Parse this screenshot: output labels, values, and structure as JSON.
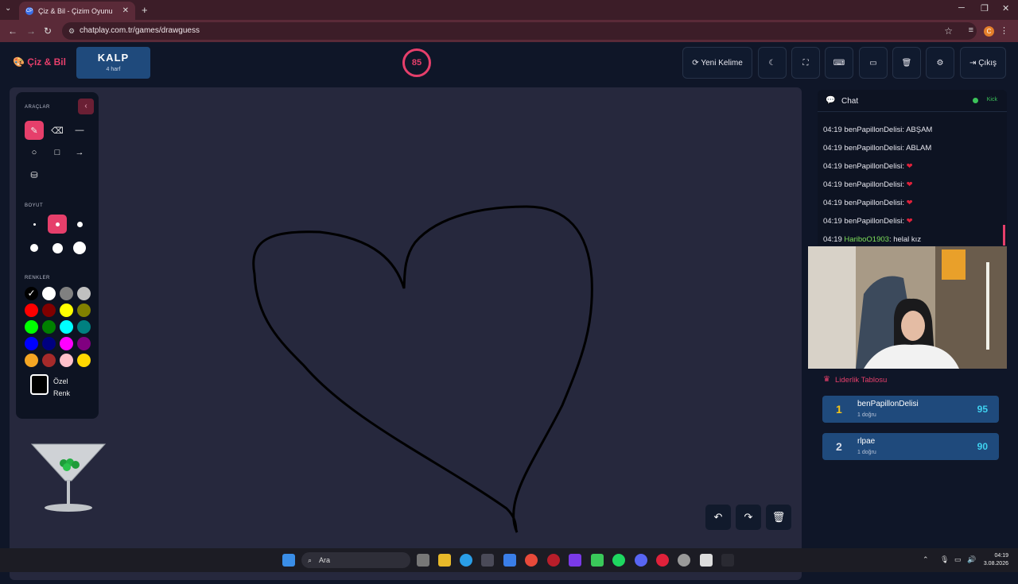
{
  "browser": {
    "tab_title": "Çiz & Bil - Çizim Oyunu",
    "url": "chatplay.com.tr/games/drawguess",
    "profile_initial": "C"
  },
  "header": {
    "logo": "Çiz & Bil",
    "word": "KALP",
    "word_hint": "4 harf",
    "timer": "85",
    "new_word": "Yeni Kelime",
    "exit": "Çıkış"
  },
  "tools": {
    "tools_label": "ARAÇLAR",
    "size_label": "BOYUT",
    "colors_label": "RENKLER",
    "custom_color": "Özel",
    "custom_color2": "Renk",
    "colors": [
      "#000000",
      "#ffffff",
      "#808080",
      "#c0c0c0",
      "#ff0000",
      "#800000",
      "#ffff00",
      "#808000",
      "#00ff00",
      "#008000",
      "#00ffff",
      "#008080",
      "#0000ff",
      "#000080",
      "#ff00ff",
      "#800080",
      "#f5a623",
      "#a52a2a",
      "#ffc0cb",
      "#ffd700"
    ]
  },
  "chat": {
    "title": "Chat",
    "platform": "Kick",
    "messages": [
      {
        "time": "04:19",
        "user": "benPapillonDelisi",
        "text": "ABŞAM"
      },
      {
        "time": "04:19",
        "user": "benPapillonDelisi",
        "text": "ABLAM"
      },
      {
        "time": "04:19",
        "user": "benPapillonDelisi",
        "text": "❤"
      },
      {
        "time": "04:19",
        "user": "benPapillonDelisi",
        "text": "❤"
      },
      {
        "time": "04:19",
        "user": "benPapillonDelisi",
        "text": "❤"
      },
      {
        "time": "04:19",
        "user": "benPapillonDelisi",
        "text": "❤"
      },
      {
        "time": "04:19",
        "user": "HariboO1903",
        "text": "helal kız"
      }
    ]
  },
  "leaderboard": {
    "title": "Liderlik Tablosu",
    "rows": [
      {
        "rank": "1",
        "name": "benPapillonDelisi",
        "sub": "1 doğru",
        "score": "95"
      },
      {
        "rank": "2",
        "name": "rlpae",
        "sub": "1 doğru",
        "score": "90"
      }
    ]
  },
  "taskbar": {
    "search": "Ara",
    "time": "04:19",
    "date": "3.08.2026"
  },
  "colors": {
    "accent": "#e63f6b",
    "panel": "#0d1322",
    "canvas": "#26283d",
    "word_bg": "#1f4a7c",
    "score": "#3fd1f0",
    "rank1": "#f5c518"
  }
}
